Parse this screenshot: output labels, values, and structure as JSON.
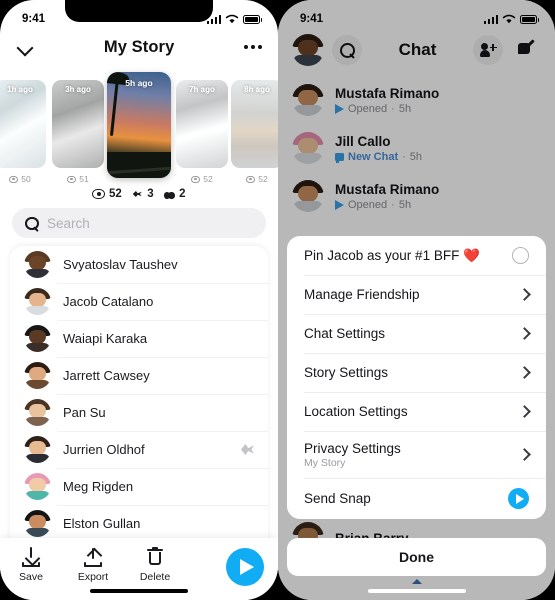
{
  "left_phone": {
    "status_bar": {
      "time": "9:41",
      "signal_icon": "cellular-bars-icon",
      "wifi_icon": "wifi-icon",
      "battery_icon": "battery-icon"
    },
    "header": {
      "back_icon": "chevron-down-icon",
      "title": "My Story",
      "more_icon": "ellipsis-icon"
    },
    "stories": [
      {
        "ago": "1h ago",
        "views": "50",
        "active": false
      },
      {
        "ago": "3h ago",
        "views": "51",
        "active": false
      },
      {
        "ago": "5h ago",
        "views": "52",
        "active": true
      },
      {
        "ago": "7h ago",
        "views": "52",
        "active": false
      },
      {
        "ago": "8h ago",
        "views": "52",
        "active": false
      }
    ],
    "totals": [
      {
        "icon": "eye-icon",
        "value": "52"
      },
      {
        "icon": "screenshot-icon",
        "value": "3"
      },
      {
        "icon": "peek-icon",
        "value": "2"
      }
    ],
    "search": {
      "icon": "search-icon",
      "placeholder": "Search",
      "value": ""
    },
    "friends": [
      {
        "name": "Svyatoslav Taushev",
        "hair": "#5a3a22",
        "face": "#6b4428",
        "body": "#2f2f38",
        "sent": false
      },
      {
        "name": "Jacob Catalano",
        "hair": "#3a2a1e",
        "face": "#e4b48d",
        "body": "#d8dce0",
        "sent": false
      },
      {
        "name": "Waiapi Karaka",
        "hair": "#171717",
        "face": "#5a3a22",
        "body": "#3a2e28",
        "sent": false
      },
      {
        "name": "Jarrett Cawsey",
        "hair": "#2b1d14",
        "face": "#e0aa80",
        "body": "#6b4a30",
        "sent": false
      },
      {
        "name": "Pan Su",
        "hair": "#4a3426",
        "face": "#e8c39e",
        "body": "#7d6250",
        "sent": false
      },
      {
        "name": "Jurrien Oldhof",
        "hair": "#2e2018",
        "face": "#e7bb92",
        "body": "#2b2b33",
        "sent": true
      },
      {
        "name": "Meg Rigden",
        "hair": "#e89ab5",
        "face": "#f0cba6",
        "body": "#4fb7a8",
        "sent": false
      },
      {
        "name": "Elston Gullan",
        "hair": "#141414",
        "face": "#c98d5f",
        "body": "#3a4a58",
        "sent": false
      }
    ],
    "actions": [
      {
        "label": "Save",
        "icon": "download-icon"
      },
      {
        "label": "Export",
        "icon": "share-upload-icon"
      },
      {
        "label": "Delete",
        "icon": "trash-icon"
      }
    ],
    "send_button": {
      "icon": "send-arrow-icon"
    }
  },
  "right_phone": {
    "status_bar": {
      "time": "9:41",
      "signal_icon": "cellular-bars-icon",
      "wifi_icon": "wifi-icon",
      "battery_icon": "battery-icon"
    },
    "header": {
      "avatar_icon": "profile-bitmoji-icon",
      "search_icon": "search-icon",
      "title": "Chat",
      "add_friend_icon": "add-friend-icon",
      "new_chat_icon": "compose-chat-icon"
    },
    "chats": [
      {
        "name": "Mustafa Rimano",
        "status": "Opened",
        "time": "5h",
        "status_icon": "snap-opened-icon",
        "hair": "#2a1d14",
        "face": "#c98d5f",
        "body": "#cfd4d8"
      },
      {
        "name": "Jill Callo",
        "status": "New Chat",
        "time": "5h",
        "status_icon": "new-chat-icon",
        "hair": "#e58fae",
        "face": "#f0c49b",
        "body": "#dcdfe2"
      },
      {
        "name": "Mustafa Rimano",
        "status": "Opened",
        "time": "5h",
        "status_icon": "snap-opened-icon",
        "hair": "#2a1d14",
        "face": "#c98d5f",
        "body": "#cfd4d8"
      },
      {
        "name": "Brian Barry",
        "status": "",
        "time": "",
        "status_icon": "",
        "hair": "#3b2a1c",
        "face": "#b07a4e",
        "body": "#55402e"
      }
    ],
    "sheet": {
      "rows": [
        {
          "label": "Pin Jacob as your #1 BFF ❤️",
          "sub": "",
          "accessory": "radio-circle"
        },
        {
          "label": "Manage Friendship",
          "sub": "",
          "accessory": "chevron-right-icon"
        },
        {
          "label": "Chat Settings",
          "sub": "",
          "accessory": "chevron-right-icon"
        },
        {
          "label": "Story Settings",
          "sub": "",
          "accessory": "chevron-right-icon"
        },
        {
          "label": "Location Settings",
          "sub": "",
          "accessory": "chevron-right-icon"
        },
        {
          "label": "Privacy Settings",
          "sub": "My Story",
          "accessory": "chevron-right-icon"
        },
        {
          "label": "Send Snap",
          "sub": "",
          "accessory": "send-circle-icon"
        }
      ],
      "done_label": "Done"
    }
  },
  "colors": {
    "accent_blue": "#10adf5",
    "link_blue": "#4a8fd6",
    "text_primary": "#15151a",
    "text_muted": "#8e8e93",
    "divider": "#ececed",
    "search_bg": "#f0f0f2"
  }
}
